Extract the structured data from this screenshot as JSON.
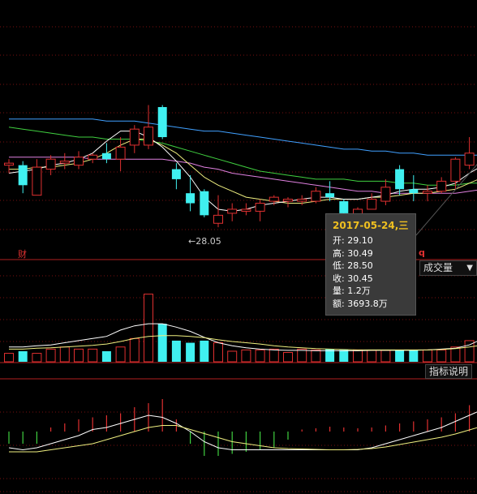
{
  "price_panel": {
    "low_marker_label": "28.05",
    "tag_left": "财",
    "tag_right": "q"
  },
  "volume_panel": {
    "dropdown": {
      "selected": "成交量",
      "arrow": "▼"
    }
  },
  "indicator_panel": {
    "button_label": "指标说明"
  },
  "tooltip": {
    "date": "2017-05-24,三",
    "rows": [
      {
        "label": "开:",
        "value": "29.10"
      },
      {
        "label": "高:",
        "value": "30.49"
      },
      {
        "label": "低:",
        "value": "28.50"
      },
      {
        "label": "收:",
        "value": "30.45"
      },
      {
        "label": "量:",
        "value": "1.2万"
      },
      {
        "label": "额:",
        "value": "3693.8万"
      }
    ]
  },
  "colors": {
    "up": "#e03030",
    "down": "#40f0f0",
    "ma5": "#ffffff",
    "ma10": "#f0f080",
    "ma20": "#e080e0",
    "ma30": "#40d040",
    "ma60": "#40a0ff",
    "grid": "#7a1010",
    "panel_border": "#b02020"
  },
  "chart_data": {
    "type": "candlestick",
    "price_range": [
      27.5,
      35.8
    ],
    "candles": [
      {
        "o": 31.2,
        "h": 31.5,
        "l": 30.8,
        "c": 31.3
      },
      {
        "o": 31.2,
        "h": 31.4,
        "l": 29.8,
        "c": 30.2
      },
      {
        "o": 29.7,
        "h": 31.5,
        "l": 29.7,
        "c": 31.1
      },
      {
        "o": 31.0,
        "h": 31.7,
        "l": 30.7,
        "c": 31.5
      },
      {
        "o": 31.3,
        "h": 31.8,
        "l": 31.0,
        "c": 31.4
      },
      {
        "o": 31.2,
        "h": 31.9,
        "l": 31.0,
        "c": 31.6
      },
      {
        "o": 31.5,
        "h": 31.8,
        "l": 31.3,
        "c": 31.7
      },
      {
        "o": 31.8,
        "h": 32.3,
        "l": 31.3,
        "c": 31.5
      },
      {
        "o": 31.5,
        "h": 32.6,
        "l": 30.9,
        "c": 32.1
      },
      {
        "o": 32.2,
        "h": 33.2,
        "l": 31.8,
        "c": 33.0
      },
      {
        "o": 32.2,
        "h": 34.2,
        "l": 32.0,
        "c": 33.1
      },
      {
        "o": 34.1,
        "h": 34.2,
        "l": 32.5,
        "c": 32.6
      },
      {
        "o": 31.0,
        "h": 31.3,
        "l": 30.0,
        "c": 30.5
      },
      {
        "o": 29.8,
        "h": 30.7,
        "l": 28.9,
        "c": 29.3
      },
      {
        "o": 29.9,
        "h": 30.0,
        "l": 28.6,
        "c": 28.7
      },
      {
        "o": 28.3,
        "h": 29.7,
        "l": 28.1,
        "c": 28.7
      },
      {
        "o": 28.8,
        "h": 29.3,
        "l": 28.4,
        "c": 29.0
      },
      {
        "o": 28.9,
        "h": 29.3,
        "l": 28.7,
        "c": 29.0
      },
      {
        "o": 28.9,
        "h": 29.5,
        "l": 28.4,
        "c": 29.3
      },
      {
        "o": 29.4,
        "h": 29.7,
        "l": 29.2,
        "c": 29.6
      },
      {
        "o": 29.4,
        "h": 29.6,
        "l": 29.1,
        "c": 29.5
      },
      {
        "o": 29.4,
        "h": 29.7,
        "l": 29.2,
        "c": 29.5
      },
      {
        "o": 29.4,
        "h": 30.1,
        "l": 29.3,
        "c": 29.9
      },
      {
        "o": 29.8,
        "h": 30.4,
        "l": 29.4,
        "c": 29.6
      },
      {
        "o": 29.4,
        "h": 29.5,
        "l": 28.6,
        "c": 28.8
      },
      {
        "o": 28.4,
        "h": 29.1,
        "l": 28.2,
        "c": 29.0
      },
      {
        "o": 29.0,
        "h": 29.8,
        "l": 29.0,
        "c": 29.5
      },
      {
        "o": 29.4,
        "h": 30.5,
        "l": 29.2,
        "c": 30.1
      },
      {
        "o": 31.0,
        "h": 31.2,
        "l": 29.7,
        "c": 30.0
      },
      {
        "o": 30.0,
        "h": 30.7,
        "l": 29.4,
        "c": 29.8
      },
      {
        "o": 29.8,
        "h": 30.2,
        "l": 29.4,
        "c": 29.9
      },
      {
        "o": 29.9,
        "h": 30.6,
        "l": 29.8,
        "c": 30.4
      },
      {
        "o": 30.4,
        "h": 31.6,
        "l": 30.0,
        "c": 31.5
      },
      {
        "o": 31.2,
        "h": 32.6,
        "l": 31.0,
        "c": 31.8
      },
      {
        "o": 31.8,
        "h": 31.9,
        "l": 31.4,
        "c": 31.6
      },
      {
        "o": 31.1,
        "h": 32.6,
        "l": 31.0,
        "c": 32.5
      }
    ],
    "ma5": [
      30.8,
      30.9,
      31.0,
      31.2,
      31.3,
      31.5,
      31.8,
      32.4,
      32.9,
      32.9,
      32.6,
      32.1,
      31.4,
      30.6,
      29.6,
      29.0,
      28.9,
      29.0,
      29.2,
      29.3,
      29.4,
      29.5,
      29.6,
      29.6,
      29.5,
      29.5,
      29.6,
      29.7,
      29.9,
      30.0,
      30.0,
      30.1,
      30.3,
      30.8,
      31.2,
      31.6
    ],
    "ma10": [
      31.0,
      31.0,
      31.1,
      31.1,
      31.2,
      31.3,
      31.5,
      31.8,
      32.2,
      32.5,
      32.5,
      32.2,
      31.8,
      31.2,
      30.6,
      30.2,
      29.9,
      29.6,
      29.5,
      29.4,
      29.3,
      29.3,
      29.4,
      29.5,
      29.5,
      29.5,
      29.6,
      29.6,
      29.7,
      29.8,
      29.8,
      29.9,
      30.0,
      30.3,
      30.6,
      31.0
    ],
    "ma20": [
      31.6,
      31.6,
      31.6,
      31.6,
      31.6,
      31.6,
      31.5,
      31.5,
      31.5,
      31.5,
      31.5,
      31.5,
      31.4,
      31.3,
      31.1,
      31.0,
      30.8,
      30.7,
      30.6,
      30.5,
      30.4,
      30.3,
      30.2,
      30.1,
      30.0,
      29.9,
      29.9,
      29.8,
      29.8,
      29.8,
      29.8,
      29.8,
      29.8,
      29.9,
      30.0,
      30.1
    ],
    "ma30": [
      33.1,
      33.0,
      32.9,
      32.8,
      32.7,
      32.6,
      32.6,
      32.5,
      32.5,
      32.5,
      32.4,
      32.3,
      32.1,
      31.9,
      31.7,
      31.5,
      31.3,
      31.1,
      30.9,
      30.8,
      30.7,
      30.6,
      30.5,
      30.5,
      30.5,
      30.4,
      30.4,
      30.4,
      30.3,
      30.3,
      30.2,
      30.2,
      30.2,
      30.3,
      30.3,
      30.5
    ],
    "ma60": [
      33.5,
      33.5,
      33.5,
      33.5,
      33.5,
      33.5,
      33.5,
      33.4,
      33.4,
      33.4,
      33.3,
      33.2,
      33.1,
      33.0,
      32.9,
      32.9,
      32.8,
      32.7,
      32.6,
      32.5,
      32.4,
      32.3,
      32.2,
      32.1,
      32.0,
      32.0,
      31.9,
      31.9,
      31.8,
      31.8,
      31.7,
      31.7,
      31.7,
      31.7,
      31.7,
      31.7
    ],
    "volume": [
      0.2,
      0.25,
      0.2,
      0.3,
      0.35,
      0.3,
      0.3,
      0.25,
      0.35,
      0.55,
      1.6,
      0.9,
      0.5,
      0.45,
      0.5,
      0.45,
      0.25,
      0.28,
      0.28,
      0.3,
      0.22,
      0.3,
      0.28,
      0.3,
      0.28,
      0.28,
      0.27,
      0.27,
      0.28,
      0.27,
      0.28,
      0.28,
      0.35,
      0.5,
      0.6,
      1.1
    ],
    "vol_ma1": [
      0.35,
      0.35,
      0.38,
      0.4,
      0.45,
      0.5,
      0.55,
      0.6,
      0.75,
      0.85,
      0.9,
      0.9,
      0.82,
      0.72,
      0.58,
      0.45,
      0.38,
      0.33,
      0.3,
      0.28,
      0.27,
      0.27,
      0.26,
      0.26,
      0.26,
      0.26,
      0.27,
      0.27,
      0.27,
      0.27,
      0.28,
      0.3,
      0.32,
      0.4,
      0.55,
      0.7
    ],
    "vol_ma2": [
      0.3,
      0.3,
      0.32,
      0.33,
      0.35,
      0.37,
      0.39,
      0.42,
      0.48,
      0.55,
      0.6,
      0.62,
      0.62,
      0.6,
      0.57,
      0.52,
      0.48,
      0.45,
      0.42,
      0.38,
      0.35,
      0.33,
      0.31,
      0.3,
      0.29,
      0.28,
      0.28,
      0.28,
      0.28,
      0.28,
      0.28,
      0.29,
      0.31,
      0.35,
      0.4,
      0.48
    ],
    "macd_hist": [
      -0.3,
      -0.3,
      -0.3,
      0.1,
      0.2,
      0.3,
      0.35,
      0.4,
      0.45,
      0.6,
      0.7,
      0.8,
      0.3,
      -0.3,
      -0.6,
      -0.6,
      -0.55,
      -0.5,
      -0.45,
      -0.4,
      -0.2,
      0.05,
      0.08,
      0.12,
      0.1,
      0.08,
      0.1,
      0.15,
      0.2,
      0.25,
      0.3,
      0.35,
      0.45,
      0.65,
      0.8,
      1.0
    ],
    "macd_dif": [
      -0.4,
      -0.45,
      -0.4,
      -0.3,
      -0.2,
      -0.1,
      0.05,
      0.1,
      0.2,
      0.3,
      0.4,
      0.35,
      0.2,
      0.0,
      -0.25,
      -0.4,
      -0.45,
      -0.45,
      -0.45,
      -0.45,
      -0.45,
      -0.45,
      -0.45,
      -0.45,
      -0.45,
      -0.45,
      -0.4,
      -0.3,
      -0.2,
      -0.1,
      0.0,
      0.1,
      0.25,
      0.4,
      0.55,
      0.75
    ],
    "macd_dea": [
      -0.5,
      -0.5,
      -0.5,
      -0.45,
      -0.4,
      -0.35,
      -0.3,
      -0.2,
      -0.1,
      0.0,
      0.1,
      0.15,
      0.15,
      0.05,
      -0.05,
      -0.15,
      -0.25,
      -0.3,
      -0.35,
      -0.4,
      -0.42,
      -0.43,
      -0.44,
      -0.45,
      -0.45,
      -0.44,
      -0.42,
      -0.38,
      -0.32,
      -0.26,
      -0.2,
      -0.14,
      -0.06,
      0.04,
      0.14,
      0.28
    ]
  }
}
